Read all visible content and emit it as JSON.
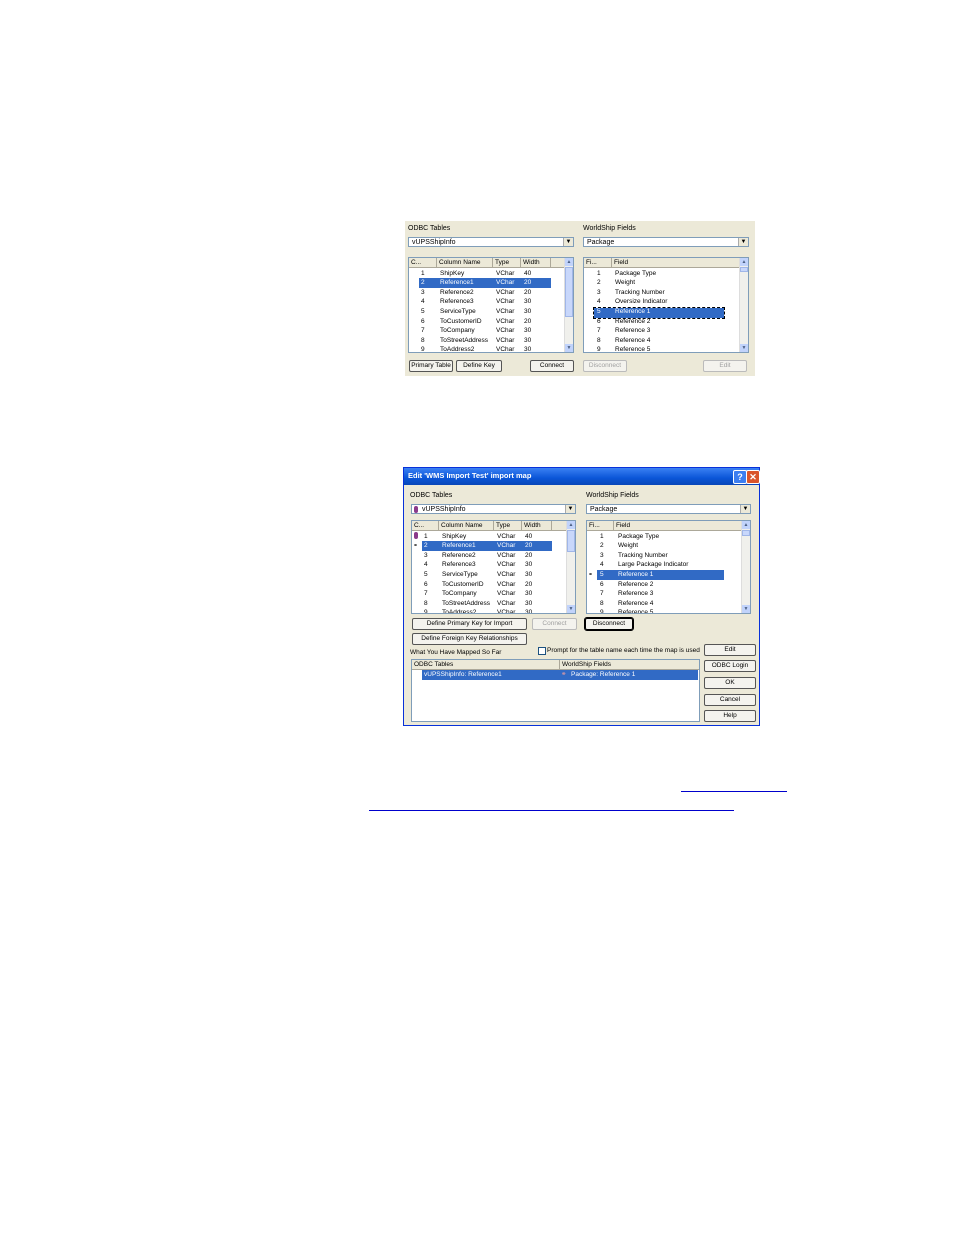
{
  "fig1": {
    "odbc_label": "ODBC Tables",
    "odbc_value": "vUPSShipInfo",
    "ws_label": "WorldShip Fields",
    "ws_value": "Package",
    "left_headers": [
      "C...",
      "Column Name",
      "Type",
      "Width"
    ],
    "left_rows": [
      [
        "1",
        "ShipKey",
        "VChar",
        "40"
      ],
      [
        "2",
        "Reference1",
        "VChar",
        "20"
      ],
      [
        "3",
        "Reference2",
        "VChar",
        "20"
      ],
      [
        "4",
        "Reference3",
        "VChar",
        "30"
      ],
      [
        "5",
        "ServiceType",
        "VChar",
        "30"
      ],
      [
        "6",
        "ToCustomerID",
        "VChar",
        "20"
      ],
      [
        "7",
        "ToCompany",
        "VChar",
        "30"
      ],
      [
        "8",
        "ToStreetAddress",
        "VChar",
        "30"
      ],
      [
        "9",
        "ToAddress2",
        "VChar",
        "30"
      ]
    ],
    "right_headers": [
      "Fi...",
      "Field"
    ],
    "right_rows": [
      [
        "1",
        "Package Type"
      ],
      [
        "2",
        "Weight"
      ],
      [
        "3",
        "Tracking Number"
      ],
      [
        "4",
        "Oversize Indicator"
      ],
      [
        "5",
        "Reference 1"
      ],
      [
        "6",
        "Reference 2"
      ],
      [
        "7",
        "Reference 3"
      ],
      [
        "8",
        "Reference 4"
      ],
      [
        "9",
        "Reference 5"
      ]
    ],
    "buttons": {
      "primary_table": "Primary Table",
      "define_key": "Define Key",
      "connect": "Connect",
      "disconnect": "Disconnect",
      "edit": "Edit"
    }
  },
  "fig2": {
    "title": "Edit 'WMS Import Test' import map",
    "odbc_label": "ODBC Tables",
    "odbc_value": "vUPSShipInfo",
    "ws_label": "WorldShip Fields",
    "ws_value": "Package",
    "left_headers": [
      "C...",
      "Column Name",
      "Type",
      "Width"
    ],
    "left_rows": [
      [
        "1",
        "ShipKey",
        "VChar",
        "40"
      ],
      [
        "2",
        "Reference1",
        "VChar",
        "20"
      ],
      [
        "3",
        "Reference2",
        "VChar",
        "20"
      ],
      [
        "4",
        "Reference3",
        "VChar",
        "30"
      ],
      [
        "5",
        "ServiceType",
        "VChar",
        "30"
      ],
      [
        "6",
        "ToCustomerID",
        "VChar",
        "20"
      ],
      [
        "7",
        "ToCompany",
        "VChar",
        "30"
      ],
      [
        "8",
        "ToStreetAddress",
        "VChar",
        "30"
      ],
      [
        "9",
        "ToAddress2",
        "VChar",
        "30"
      ]
    ],
    "right_headers": [
      "Fi...",
      "Field"
    ],
    "right_rows": [
      [
        "1",
        "Package Type"
      ],
      [
        "2",
        "Weight"
      ],
      [
        "3",
        "Tracking Number"
      ],
      [
        "4",
        "Large Package Indicator"
      ],
      [
        "5",
        "Reference 1"
      ],
      [
        "6",
        "Reference 2"
      ],
      [
        "7",
        "Reference 3"
      ],
      [
        "8",
        "Reference 4"
      ],
      [
        "9",
        "Reference 5"
      ]
    ],
    "buttons": {
      "define_primary_key": "Define Primary Key for Import",
      "define_foreign_key": "Define Foreign Key Relationships",
      "connect": "Connect",
      "disconnect": "Disconnect",
      "edit": "Edit",
      "odbc_login": "ODBC Login",
      "ok": "OK",
      "cancel": "Cancel",
      "help": "Help"
    },
    "mapped_label": "What You Have Mapped So Far",
    "prompt_label": "Prompt for the table name each time the map is used",
    "mapped_headers": [
      "ODBC Tables",
      "WorldShip Fields"
    ],
    "mapped_rows": [
      [
        "vUPSShipInfo: Reference1",
        "Package: Reference 1"
      ]
    ]
  }
}
